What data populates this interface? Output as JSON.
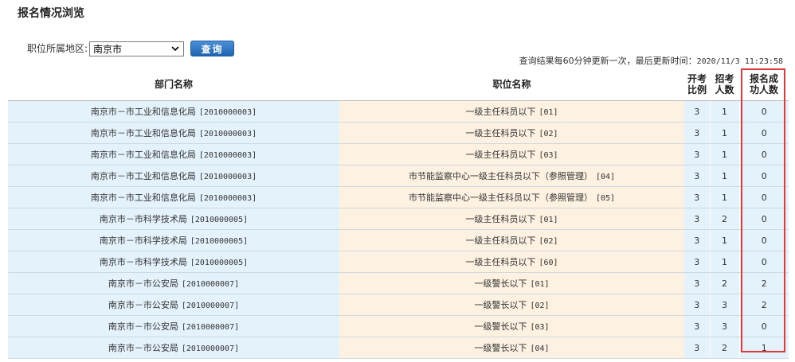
{
  "page": {
    "title": "报名情况浏览"
  },
  "filter": {
    "label": "职位所属地区:",
    "region_selected": "南京市",
    "query_button_label": "查询"
  },
  "update_note": {
    "text": "查询结果每60分钟更新一次，最后更新时间：",
    "timestamp": "2020/11/3 11:23:58"
  },
  "table": {
    "headers": {
      "dept": "部门名称",
      "position": "职位名称",
      "ratio": [
        "开考",
        "比例"
      ],
      "quota": [
        "招考",
        "人数"
      ],
      "success": [
        "报名成",
        "功人数"
      ]
    },
    "rows": [
      {
        "dept": "南京市－市工业和信息化局",
        "dept_code": "[2010000003]",
        "position": "一级主任科员以下",
        "pos_code": "[01]",
        "ratio": "3",
        "quota": "1",
        "success": "0"
      },
      {
        "dept": "南京市－市工业和信息化局",
        "dept_code": "[2010000003]",
        "position": "一级主任科员以下",
        "pos_code": "[02]",
        "ratio": "3",
        "quota": "1",
        "success": "0"
      },
      {
        "dept": "南京市－市工业和信息化局",
        "dept_code": "[2010000003]",
        "position": "一级主任科员以下",
        "pos_code": "[03]",
        "ratio": "3",
        "quota": "1",
        "success": "0"
      },
      {
        "dept": "南京市－市工业和信息化局",
        "dept_code": "[2010000003]",
        "position": "市节能监察中心一级主任科员以下（参照管理）",
        "pos_code": "[04]",
        "ratio": "3",
        "quota": "1",
        "success": "0"
      },
      {
        "dept": "南京市－市工业和信息化局",
        "dept_code": "[2010000003]",
        "position": "市节能监察中心一级主任科员以下（参照管理）",
        "pos_code": "[05]",
        "ratio": "3",
        "quota": "1",
        "success": "0"
      },
      {
        "dept": "南京市－市科学技术局",
        "dept_code": "[2010000005]",
        "position": "一级主任科员以下",
        "pos_code": "[01]",
        "ratio": "3",
        "quota": "2",
        "success": "0"
      },
      {
        "dept": "南京市－市科学技术局",
        "dept_code": "[2010000005]",
        "position": "一级主任科员以下",
        "pos_code": "[02]",
        "ratio": "3",
        "quota": "1",
        "success": "0"
      },
      {
        "dept": "南京市－市科学技术局",
        "dept_code": "[2010000005]",
        "position": "一级主任科员以下",
        "pos_code": "[60]",
        "ratio": "3",
        "quota": "1",
        "success": "0"
      },
      {
        "dept": "南京市－市公安局",
        "dept_code": "[2010000007]",
        "position": "一级警长以下",
        "pos_code": "[01]",
        "ratio": "3",
        "quota": "2",
        "success": "2"
      },
      {
        "dept": "南京市－市公安局",
        "dept_code": "[2010000007]",
        "position": "一级警长以下",
        "pos_code": "[02]",
        "ratio": "3",
        "quota": "3",
        "success": "2"
      },
      {
        "dept": "南京市－市公安局",
        "dept_code": "[2010000007]",
        "position": "一级警长以下",
        "pos_code": "[03]",
        "ratio": "3",
        "quota": "3",
        "success": "0"
      },
      {
        "dept": "南京市－市公安局",
        "dept_code": "[2010000007]",
        "position": "一级警长以下",
        "pos_code": "[04]",
        "ratio": "3",
        "quota": "2",
        "success": "1"
      }
    ]
  },
  "colors": {
    "dept_bg": "#e4f3fb",
    "position_bg": "#fdf2e2",
    "query_button": "#1e63ae",
    "highlight": "#e03b3b"
  }
}
